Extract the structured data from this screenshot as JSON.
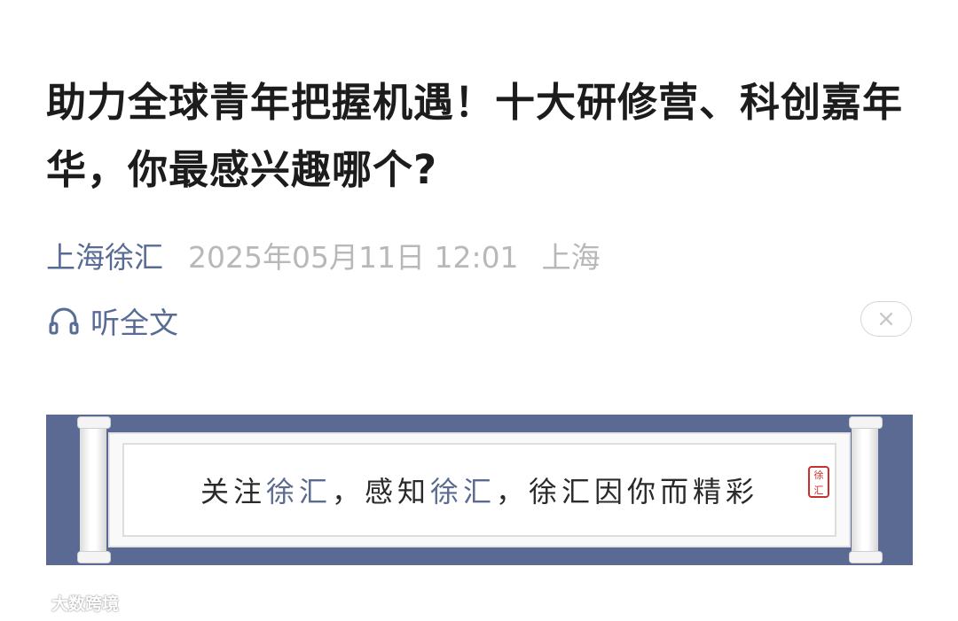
{
  "article": {
    "title": "助力全球青年把握机遇！十大研修营、科创嘉年华，你最感兴趣哪个?",
    "account": "上海徐汇",
    "date": "2025年05月11日 12:01",
    "location": "上海"
  },
  "listen": {
    "label": "听全文",
    "icon": "headphones-icon"
  },
  "close": {
    "icon": "close-icon"
  },
  "banner": {
    "slogan_parts": [
      "关注",
      "徐汇",
      "，感知",
      "徐汇",
      "，徐汇因你而精彩"
    ],
    "seal_text": "徐汇",
    "colors": {
      "background": "#5b6a92",
      "highlight": "#5b6a92"
    }
  },
  "watermark": {
    "text": "大数跨境"
  },
  "colors": {
    "link": "#576b95",
    "muted": "#b8b8b8",
    "title": "#1c1c1c"
  }
}
